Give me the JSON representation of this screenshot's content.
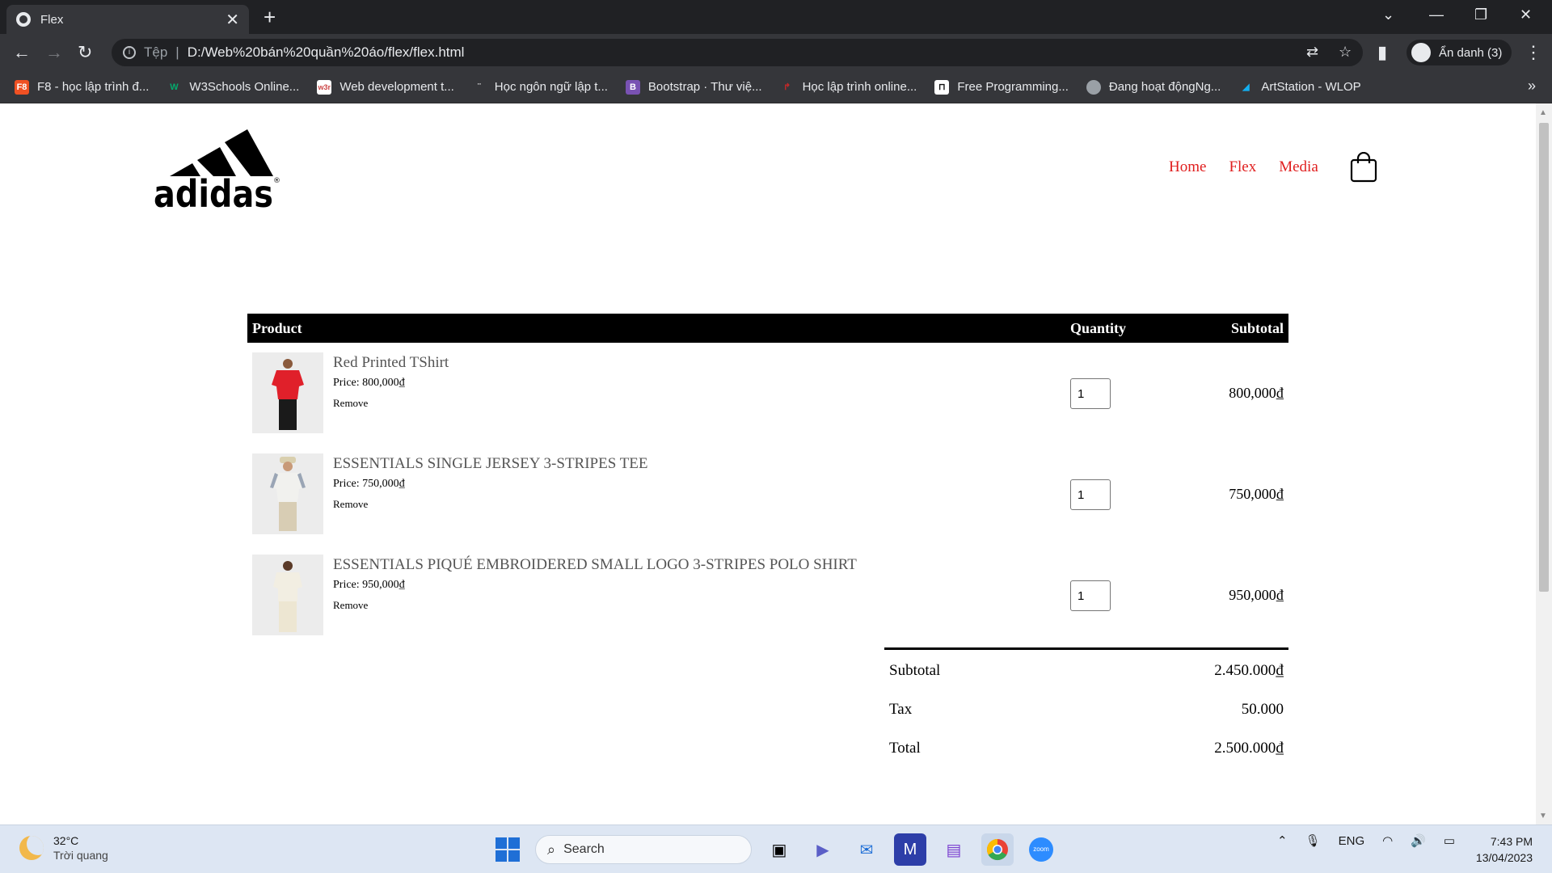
{
  "browser": {
    "tab_title": "Flex",
    "address_prefix": "Tệp",
    "url": "D:/Web%20bán%20quần%20áo/flex/flex.html",
    "profile_label": "Ẩn danh (3)",
    "bookmarks": [
      {
        "label": "F8 - học lập trình đ...",
        "icon": "f8-icon",
        "color": "#f05123"
      },
      {
        "label": "W3Schools Online...",
        "icon": "w3schools-icon",
        "color": "#04aa6d"
      },
      {
        "label": "Web development t...",
        "icon": "w3r-icon",
        "color": "#ffffff"
      },
      {
        "label": "Học ngôn ngữ lập t...",
        "icon": "page-icon",
        "color": "#35363a"
      },
      {
        "label": "Bootstrap · Thư việ...",
        "icon": "bootstrap-icon",
        "color": "#7952b3"
      },
      {
        "label": "Học lập trình online...",
        "icon": "arrow-icon",
        "color": "#c62828"
      },
      {
        "label": "Free Programming...",
        "icon": "fcc-icon",
        "color": "#111111"
      },
      {
        "label": "Đang hoạt độngNg...",
        "icon": "globe-icon",
        "color": "#9aa0a6"
      },
      {
        "label": "ArtStation - WLOP",
        "icon": "artstation-icon",
        "color": "#13aff0"
      }
    ]
  },
  "nav": {
    "links": [
      "Home",
      "Flex",
      "Media"
    ],
    "link_color": "#e01e1e"
  },
  "cart": {
    "headers": {
      "product": "Product",
      "quantity": "Quantity",
      "subtotal": "Subtotal"
    },
    "items": [
      {
        "name": "Red Printed TShirt",
        "price": "Price: 800,000₫",
        "remove": "Remove",
        "quantity": "1",
        "subtotal": "800,000₫",
        "shirt_color": "#e0202a"
      },
      {
        "name": "ESSENTIALS SINGLE JERSEY 3-STRIPES TEE",
        "price": "Price: 750,000₫",
        "remove": "Remove",
        "quantity": "1",
        "subtotal": "750,000₫",
        "shirt_color": "#f1f1ee"
      },
      {
        "name": "ESSENTIALS PIQUÉ EMBROIDERED SMALL LOGO 3-STRIPES POLO SHIRT",
        "price": "Price: 950,000₫",
        "remove": "Remove",
        "quantity": "1",
        "subtotal": "950,000₫",
        "shirt_color": "#f2eee2"
      }
    ],
    "totals": [
      {
        "label": "Subtotal",
        "value": "2.450.000₫"
      },
      {
        "label": "Tax",
        "value": "50.000"
      },
      {
        "label": "Total",
        "value": "2.500.000₫"
      }
    ]
  },
  "taskbar": {
    "temp": "32°C",
    "weather": "Trời quang",
    "search": "Search",
    "lang": "ENG",
    "time": "7:43 PM",
    "date": "13/04/2023"
  }
}
